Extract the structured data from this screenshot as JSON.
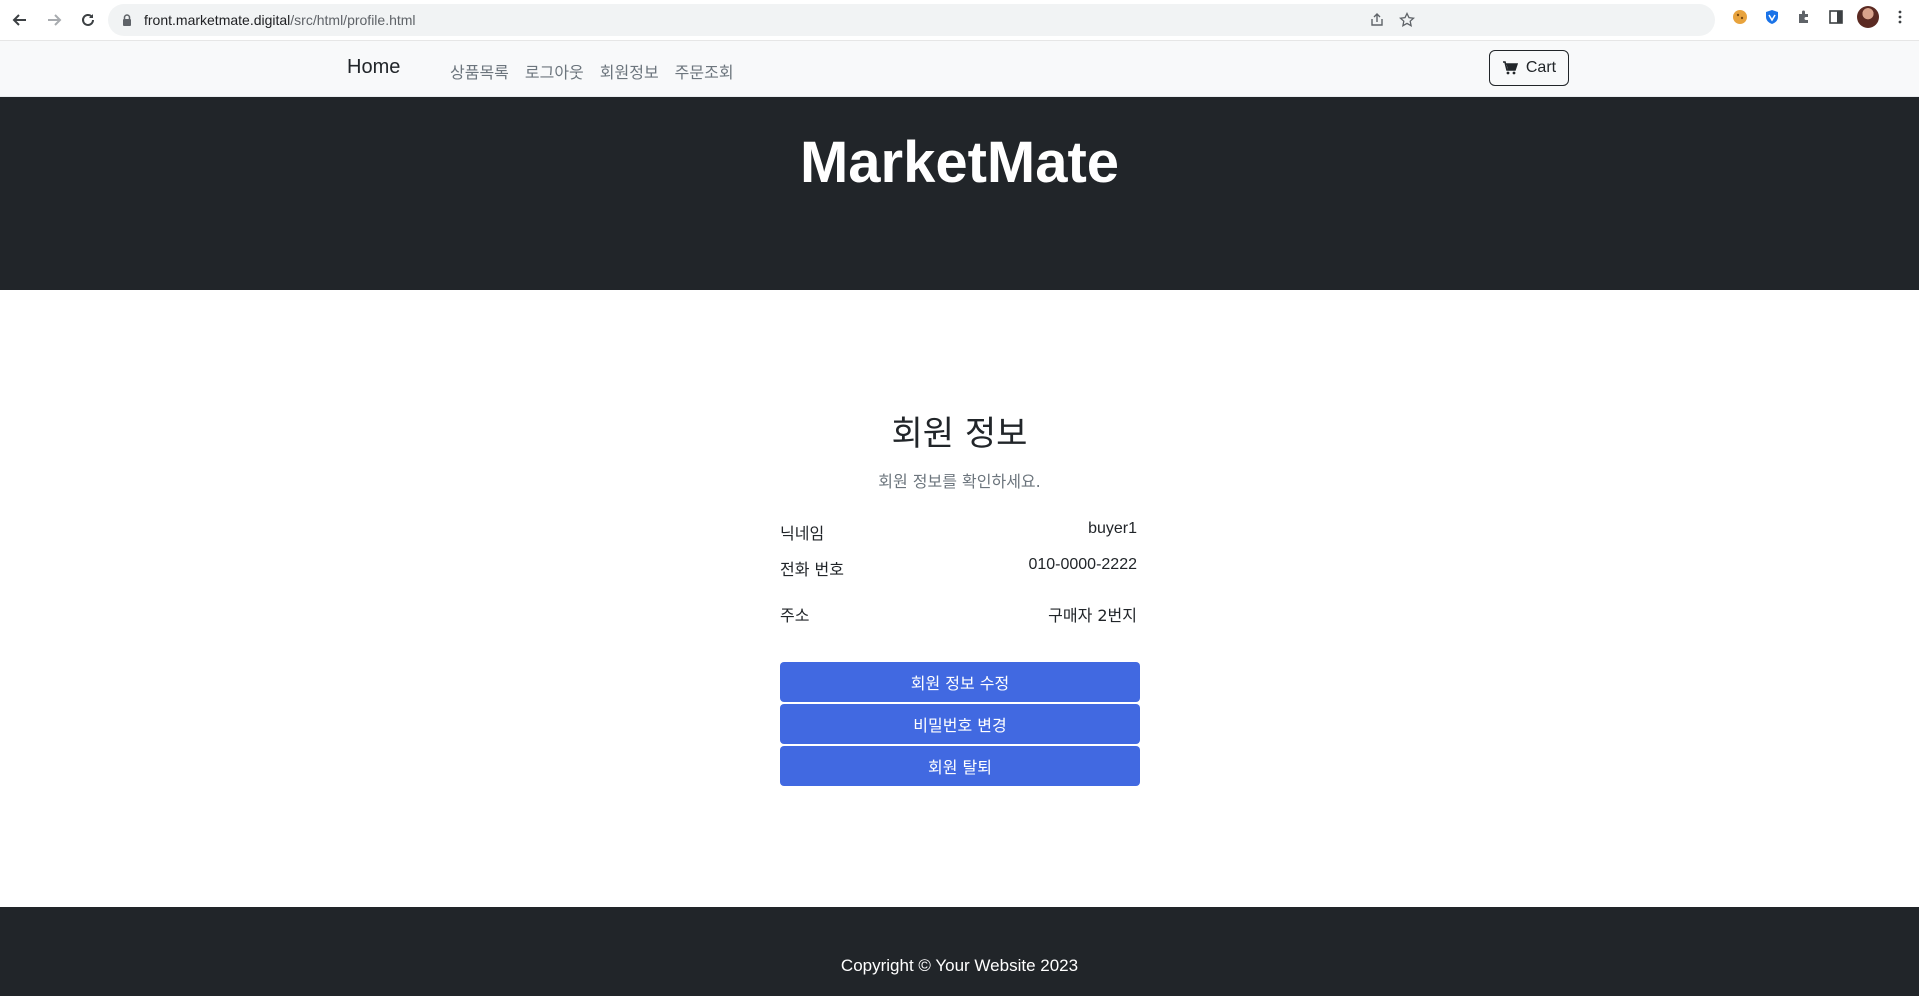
{
  "browser": {
    "url_host": "front.marketmate.digital",
    "url_path": "/src/html/profile.html"
  },
  "navbar": {
    "brand": "Home",
    "menu": [
      "상품목록",
      "로그아웃",
      "회원정보",
      "주문조회"
    ],
    "cart_label": "Cart"
  },
  "hero": {
    "title": "MarketMate"
  },
  "profile": {
    "title": "회원 정보",
    "subtitle": "회원 정보를 확인하세요.",
    "fields": [
      {
        "label": "닉네임",
        "value": "buyer1"
      },
      {
        "label": "전화 번호",
        "value": "010-0000-2222"
      },
      {
        "label": "주소",
        "value": "구매자 2번지"
      }
    ],
    "buttons": {
      "edit": "회원 정보 수정",
      "password": "비밀번호 변경",
      "withdraw": "회원 탈퇴"
    }
  },
  "footer": {
    "copyright": "Copyright © Your Website 2023"
  },
  "colors": {
    "dark": "#212529",
    "button": "#4169e1",
    "navbar_bg": "#f8f9fa"
  }
}
